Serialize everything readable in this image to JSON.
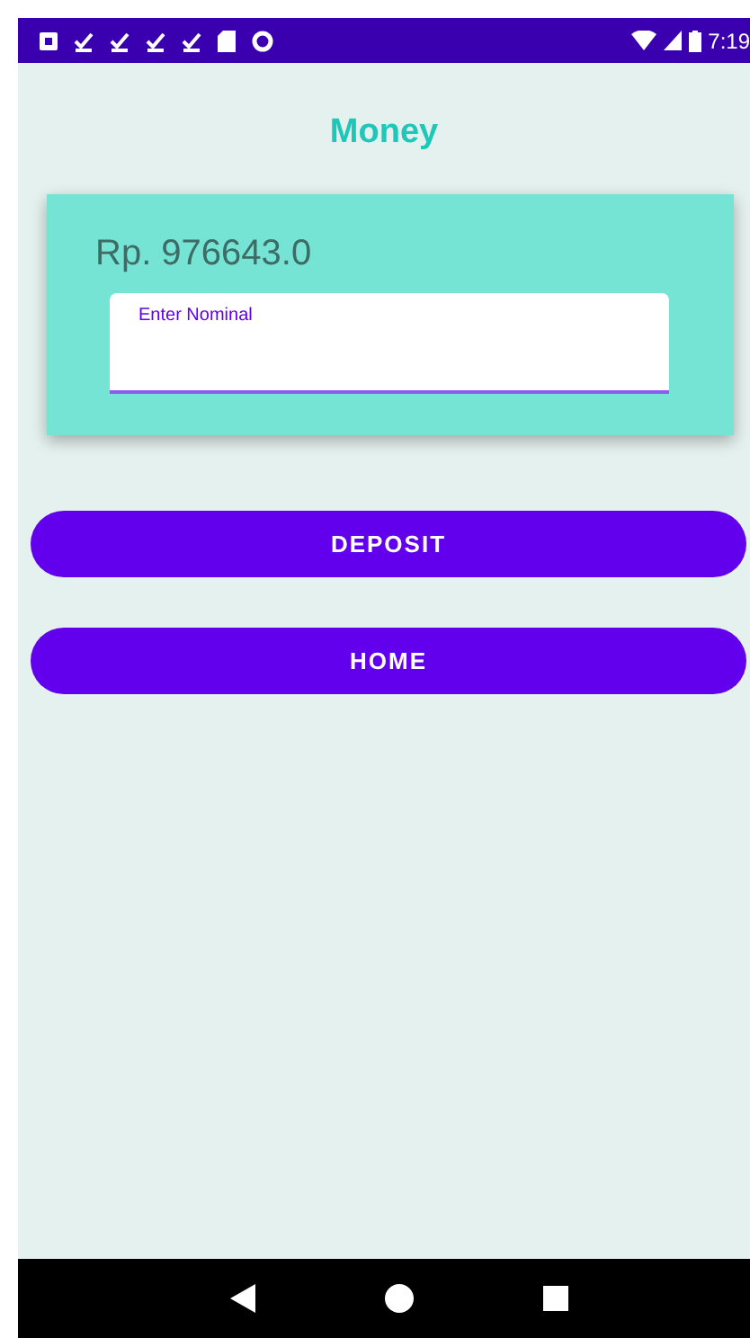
{
  "status_bar": {
    "time": "7:19"
  },
  "title": "Money",
  "balance": "Rp. 976643.0",
  "nominal_field": {
    "label": "Enter Nominal",
    "focused": true
  },
  "buttons": [
    {
      "label": "DEPOSIT"
    },
    {
      "label": "HOME"
    }
  ]
}
